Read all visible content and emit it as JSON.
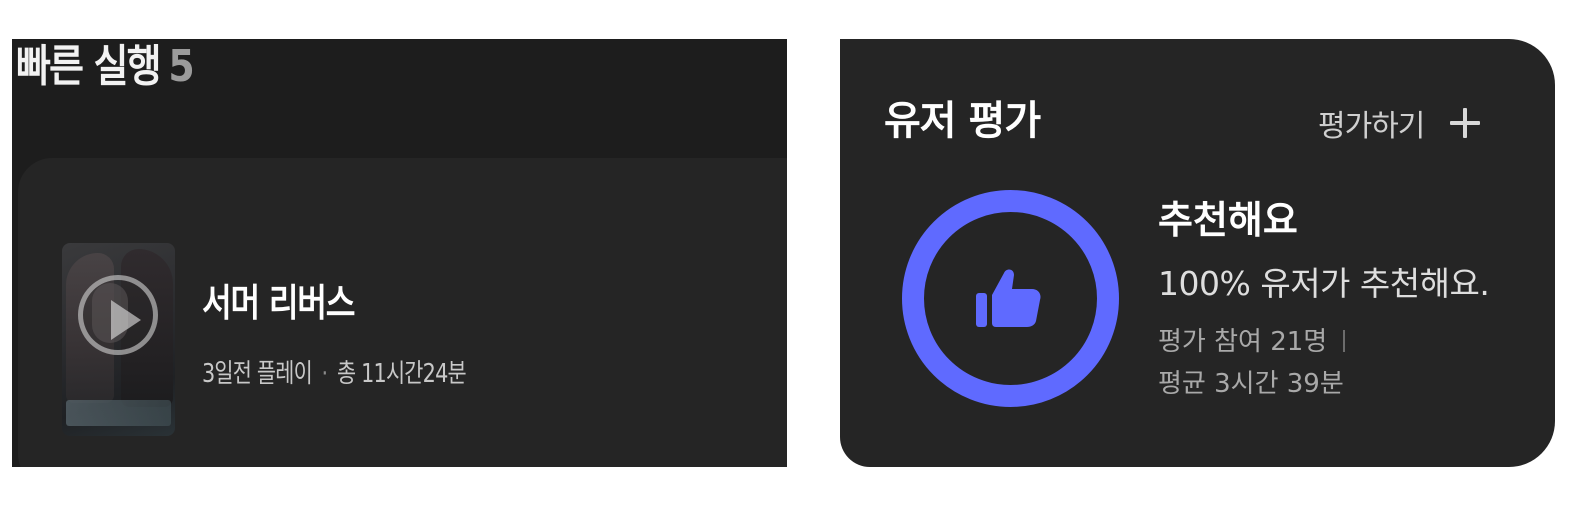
{
  "quick_launch": {
    "title": "빠른 실행",
    "count": "5",
    "game": {
      "name": "서머 리버스",
      "last_played": "3일전 플레이",
      "separator": "·",
      "total_playtime": "총 11시간24분"
    }
  },
  "user_rating": {
    "title": "유저 평가",
    "rate_button_label": "평가하기",
    "verdict": "추천해요",
    "percent_text": "100% 유저가 추천해요.",
    "participants": "평가 참여 21명",
    "average": "평균 3시간 39분",
    "accent_color": "#5f6aff"
  },
  "icons": {
    "play": "play-icon",
    "plus": "plus-icon",
    "thumbs_up": "thumbs-up-icon"
  }
}
